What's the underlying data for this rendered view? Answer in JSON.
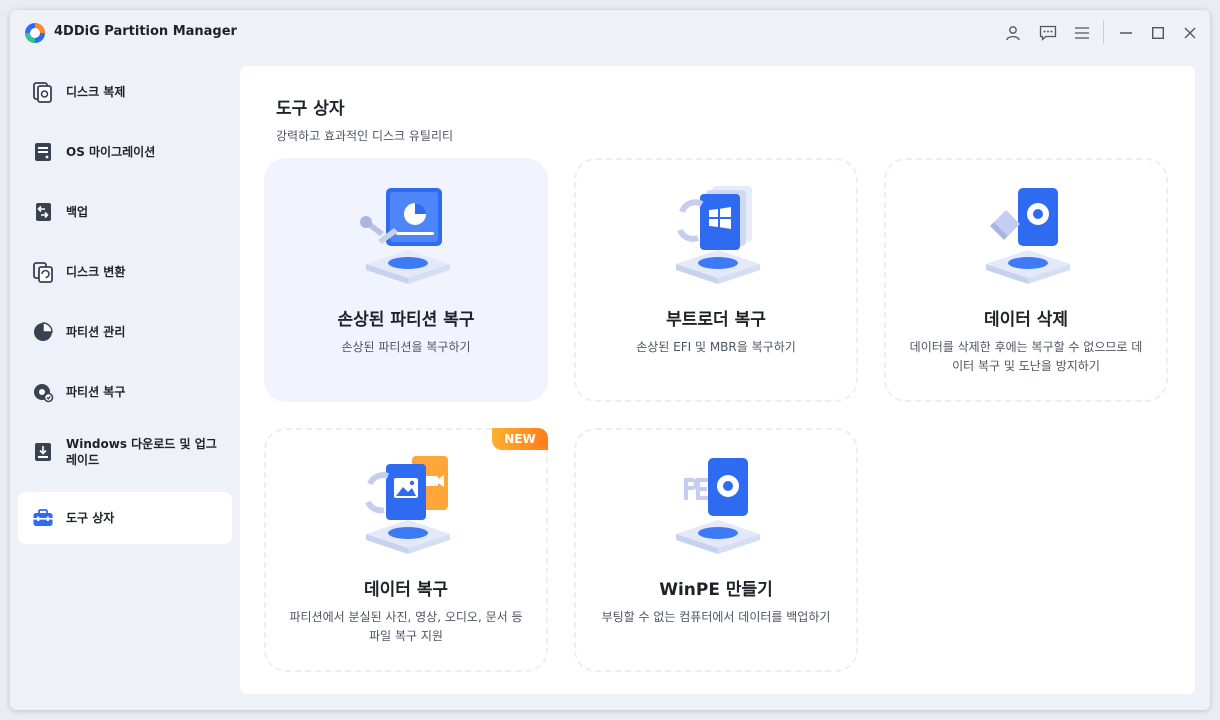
{
  "app": {
    "title": "4DDiG Partition Manager"
  },
  "titlebar": {
    "buttons": [
      "user-icon",
      "feedback-icon",
      "menu-icon",
      "minimize-icon",
      "maximize-icon",
      "close-icon"
    ]
  },
  "sidebar": {
    "items": [
      {
        "label": "디스크 복제",
        "icon": "disk-clone-icon"
      },
      {
        "label": "OS 마이그레이션",
        "icon": "os-migration-icon"
      },
      {
        "label": "백업",
        "icon": "backup-icon"
      },
      {
        "label": "디스크 변환",
        "icon": "disk-convert-icon"
      },
      {
        "label": "파티션 관리",
        "icon": "partition-pie-icon"
      },
      {
        "label": "파티션 복구",
        "icon": "partition-recovery-icon"
      },
      {
        "label": "Windows 다운로드 및 업그레이드",
        "icon": "windows-download-icon"
      },
      {
        "label": "도구 상자",
        "icon": "toolbox-icon",
        "active": true
      }
    ]
  },
  "main": {
    "title": "도구 상자",
    "subtitle": "강력하고 효과적인 디스크 유틸리티",
    "cards": [
      {
        "title": "손상된 파티션 복구",
        "desc": "손상된 파티션을 복구하기",
        "icon": "partition-repair-icon"
      },
      {
        "title": "부트로더 복구",
        "desc": "손상된 EFI 및 MBR을 복구하기",
        "icon": "bootloader-repair-icon"
      },
      {
        "title": "데이터 삭제",
        "desc": "데이터를 삭제한 후에는 복구할 수 없으므로 데이터 복구 및 도난을 방지하기",
        "icon": "data-wipe-icon"
      },
      {
        "title": "데이터 복구",
        "desc": "파티션에서 분실된 사진, 영상, 오디오, 문서 등 파일 복구 지원",
        "icon": "data-recovery-icon",
        "badge": "NEW"
      },
      {
        "title": "WinPE 만들기",
        "desc": "부팅할 수 없는 컴퓨터에서 데이터를 백업하기",
        "icon": "winpe-icon"
      }
    ]
  },
  "colors": {
    "accent": "#2f6bf0",
    "badge": "#ff8a1f",
    "card_hover": "#f1f4fe"
  }
}
